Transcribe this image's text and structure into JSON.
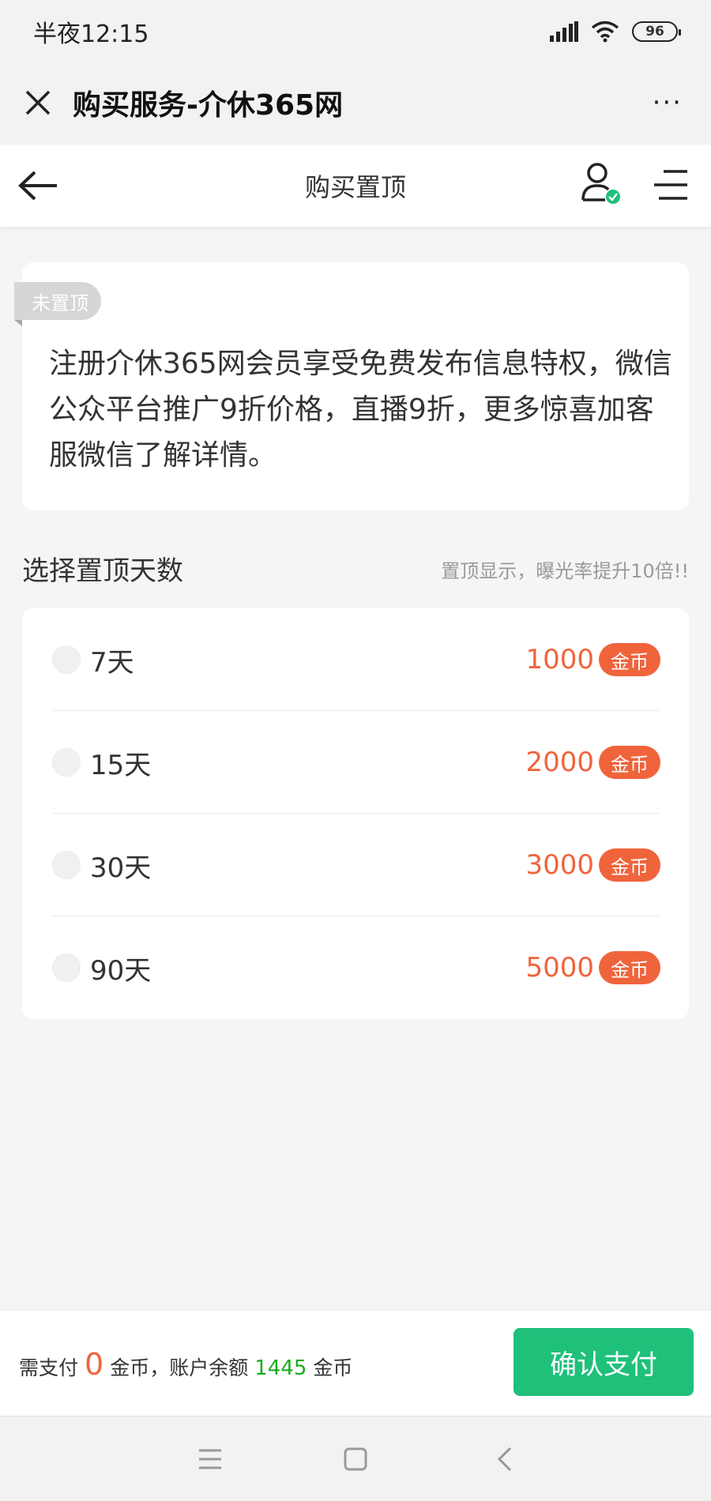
{
  "status_bar": {
    "time": "半夜12:15",
    "battery": "96"
  },
  "wechat_bar": {
    "title": "购买服务-介休365网",
    "more": "···"
  },
  "header": {
    "title": "购买置顶"
  },
  "notice": {
    "tag": "未置顶",
    "text": "注册介休365网会员享受免费发布信息特权，微信公众平台推广9折价格，直播9折，更多惊喜加客服微信了解详情。"
  },
  "section": {
    "title": "选择置顶天数",
    "hint": "置顶显示，曝光率提升10倍!!"
  },
  "options": [
    {
      "days": "7天",
      "price": "1000",
      "unit": "金币"
    },
    {
      "days": "15天",
      "price": "2000",
      "unit": "金币"
    },
    {
      "days": "30天",
      "price": "3000",
      "unit": "金币"
    },
    {
      "days": "90天",
      "price": "5000",
      "unit": "金币"
    }
  ],
  "pay": {
    "need_label": "需支付",
    "amount": "0",
    "unit1": "金币，账户余额",
    "balance": "1445",
    "unit2": "金币",
    "confirm": "确认支付"
  },
  "colors": {
    "accent_green": "#1ec07a",
    "price_orange": "#f0643c",
    "balance_green": "#1aad19"
  },
  "icons": [
    "close-icon",
    "more-icon",
    "back-arrow-icon",
    "user-verified-icon",
    "menu-icon",
    "nav-menu-icon",
    "nav-home-icon",
    "nav-back-icon"
  ]
}
